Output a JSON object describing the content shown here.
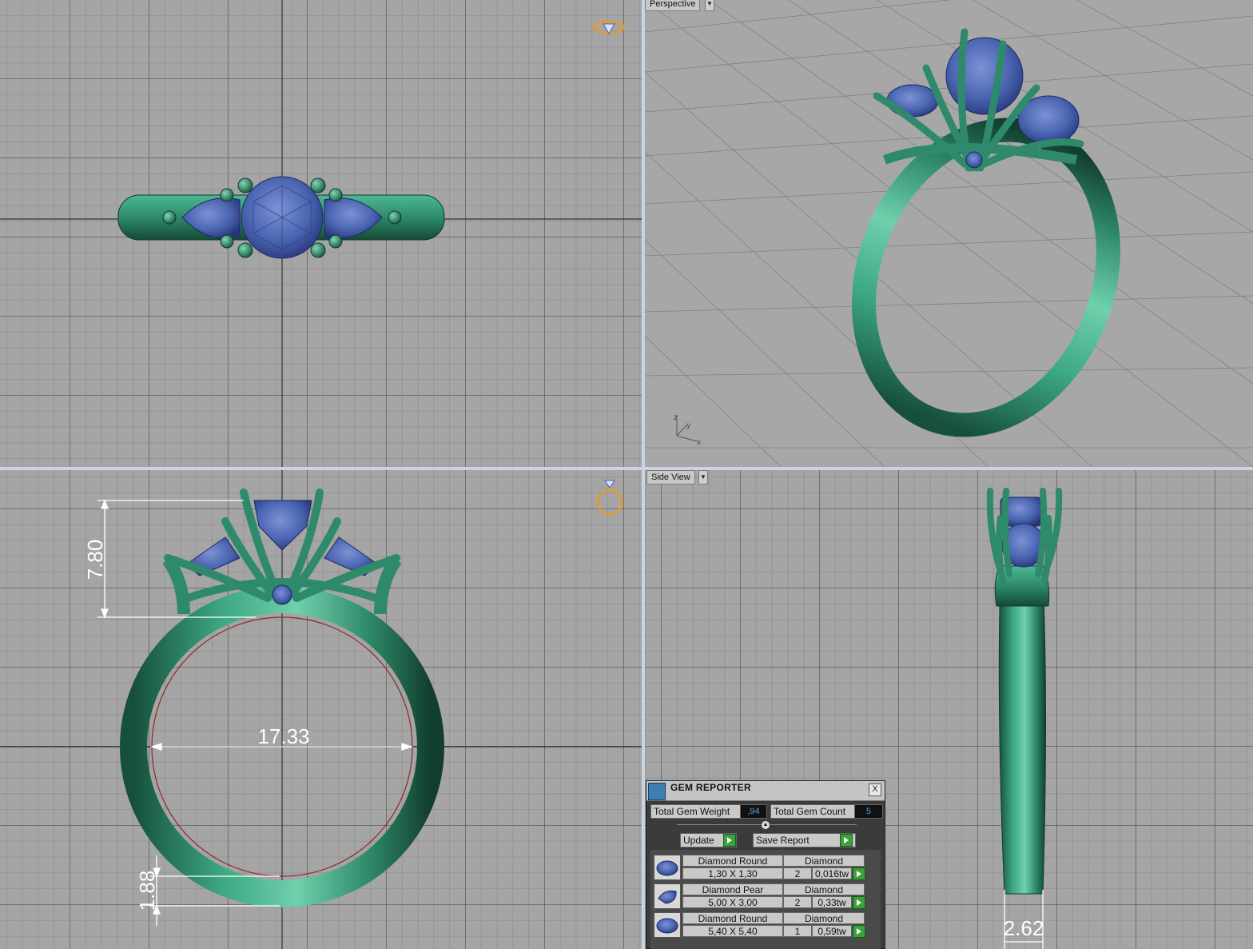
{
  "viewports": {
    "top_label": "",
    "perspective_label": "Perspective",
    "side_label": "Side View",
    "axis": {
      "z": "z",
      "y": "y",
      "x": "x"
    }
  },
  "dimensions": {
    "height": "7.80",
    "inner_diameter": "17.33",
    "band_thickness": "1.88",
    "band_width": "2.62"
  },
  "gem_reporter": {
    "title": "GEM REPORTER",
    "close_label": "X",
    "total_weight_label": "Total Gem Weight",
    "total_weight_value": ",94",
    "total_count_label": "Total Gem Count",
    "total_count_value": "5",
    "update_label": "Update",
    "save_report_label": "Save Report",
    "gems": [
      {
        "name": "Diamond Round",
        "size": "1,30 X 1,30",
        "material": "Diamond",
        "count": "2",
        "weight": "0,016tw"
      },
      {
        "name": "Diamond Pear",
        "size": "5,00 X 3,00",
        "material": "Diamond",
        "count": "2",
        "weight": "0,33tw"
      },
      {
        "name": "Diamond Round",
        "size": "5,40 X 5,40",
        "material": "Diamond",
        "count": "1",
        "weight": "0,59tw"
      }
    ]
  },
  "colors": {
    "metal": "#2e8a6a",
    "gem": "#4a64b0",
    "viewport": "#a5a5a5",
    "splitter": "#c9d3e2"
  }
}
